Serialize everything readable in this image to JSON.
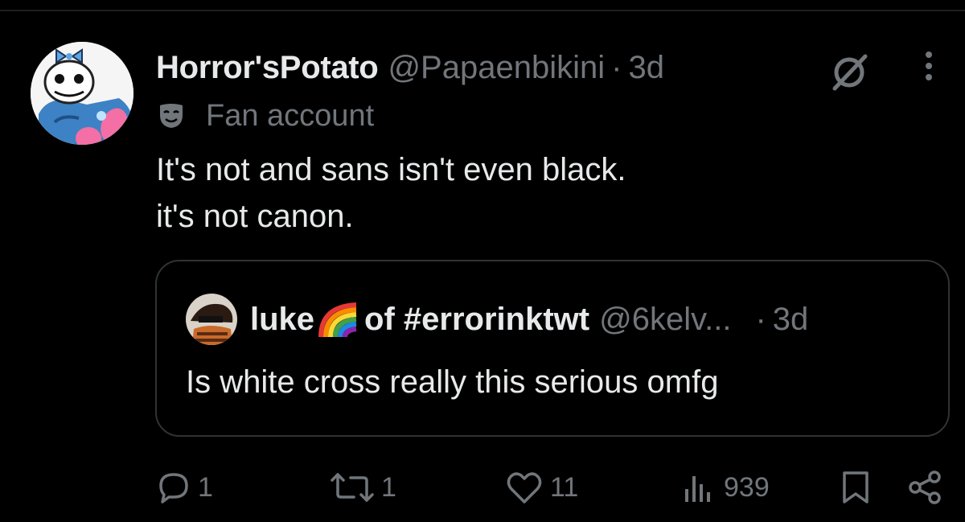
{
  "tweet": {
    "display_name": "Horror'sPotato",
    "handle": "@Papaenbikini",
    "separator": "·",
    "time": "3d",
    "badge_icon": "mask-icon",
    "badge_text": "Fan account",
    "text_line1": "It's not and sans isn't even black.",
    "text_line2": "it's not canon."
  },
  "quoted": {
    "name_part1": "luke",
    "emoji": "rainbow",
    "name_part2": "of #errorinktwt",
    "handle": "@6kelv...",
    "separator": "·",
    "time": "3d",
    "text": "Is white cross really this serious omfg"
  },
  "actions": {
    "replies": "1",
    "retweets": "1",
    "likes": "11",
    "views": "939"
  },
  "colors": {
    "background": "#000000",
    "text": "#e7e9ea",
    "muted": "#71767b",
    "border": "#2f3336"
  }
}
